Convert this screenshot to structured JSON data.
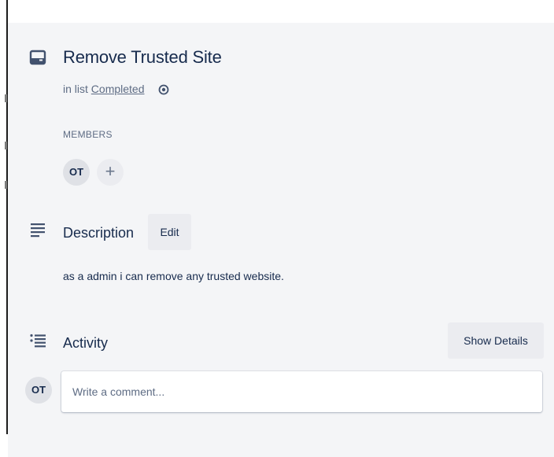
{
  "card": {
    "title": "Remove Trusted Site",
    "list_prefix": "in list",
    "list_name": "Completed"
  },
  "members": {
    "label": "MEMBERS",
    "items": [
      {
        "initials": "OT"
      }
    ],
    "add_symbol": "+"
  },
  "description": {
    "heading": "Description",
    "edit_label": "Edit",
    "text": "as a admin i can remove any trusted website."
  },
  "activity": {
    "heading": "Activity",
    "show_details_label": "Show Details",
    "avatar_initials": "OT",
    "comment_placeholder": "Write a comment..."
  },
  "icons": {
    "card": "card-icon",
    "watch": "eye-icon",
    "description": "description-lines-icon",
    "activity": "activity-list-icon"
  },
  "colors": {
    "panel_bg": "#f4f5f7",
    "button_bg": "#ebecf0",
    "text_primary": "#172b4d",
    "text_secondary": "#5e6c84"
  }
}
